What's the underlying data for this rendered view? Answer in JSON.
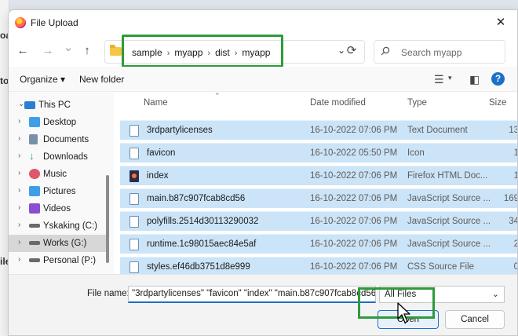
{
  "background": {
    "fragments": [
      "oa",
      "to",
      "ile"
    ]
  },
  "window": {
    "title": "File Upload",
    "close_label": "✕",
    "app_icon": "firefox-icon"
  },
  "nav": {
    "back": "←",
    "forward": "→",
    "recent": "⌄",
    "up": "↑",
    "refresh": "⟳"
  },
  "address": {
    "breadcrumb": [
      "sample",
      "myapp",
      "dist",
      "myapp"
    ]
  },
  "search": {
    "placeholder": "Search myapp"
  },
  "toolbar": {
    "organize_label": "Organize ▾",
    "new_folder_label": "New folder",
    "help_label": "?"
  },
  "sidebar": {
    "items": [
      {
        "label": "This PC",
        "chevron": "⌄",
        "icon_color": "#2a7fd4",
        "selected": false,
        "level": 0
      },
      {
        "label": "Desktop",
        "chevron": "›",
        "icon_color": "#3f9ee8",
        "selected": false,
        "level": 1
      },
      {
        "label": "Documents",
        "chevron": "›",
        "icon_color": "#7a8fa8",
        "selected": false,
        "level": 1
      },
      {
        "label": "Downloads",
        "chevron": "›",
        "icon_color": "#2f9e5b",
        "selected": false,
        "level": 1
      },
      {
        "label": "Music",
        "chevron": "›",
        "icon_color": "#e0566a",
        "selected": false,
        "level": 1
      },
      {
        "label": "Pictures",
        "chevron": "›",
        "icon_color": "#3f9ee8",
        "selected": false,
        "level": 1
      },
      {
        "label": "Videos",
        "chevron": "›",
        "icon_color": "#8a4fd0",
        "selected": false,
        "level": 1
      },
      {
        "label": "Yskaking (C:)",
        "chevron": "›",
        "icon_color": "#6a6a6a",
        "selected": false,
        "level": 1
      },
      {
        "label": "Works (G:)",
        "chevron": "›",
        "icon_color": "#6a6a6a",
        "selected": true,
        "level": 1
      },
      {
        "label": "Personal (P:)",
        "chevron": "›",
        "icon_color": "#6a6a6a",
        "selected": false,
        "level": 1
      }
    ]
  },
  "columns": {
    "name": "Name",
    "date": "Date modified",
    "type": "Type",
    "size": "Size"
  },
  "files": [
    {
      "name": "3rdpartylicenses",
      "date": "16-10-2022 07:06 PM",
      "type": "Text Document",
      "size": "13",
      "icon": "text-file-icon"
    },
    {
      "name": "favicon",
      "date": "16-10-2022 05:50 PM",
      "type": "Icon",
      "size": "1",
      "icon": "icon-file-icon"
    },
    {
      "name": "index",
      "date": "16-10-2022 07:06 PM",
      "type": "Firefox HTML Doc...",
      "size": "1",
      "icon": "html-file-icon"
    },
    {
      "name": "main.b87c907fcab8cd56",
      "date": "16-10-2022 07:06 PM",
      "type": "JavaScript Source ...",
      "size": "169",
      "icon": "js-file-icon"
    },
    {
      "name": "polyfills.2514d30113290032",
      "date": "16-10-2022 07:06 PM",
      "type": "JavaScript Source ...",
      "size": "34",
      "icon": "js-file-icon"
    },
    {
      "name": "runtime.1c98015aec84e5af",
      "date": "16-10-2022 07:06 PM",
      "type": "JavaScript Source ...",
      "size": "2",
      "icon": "js-file-icon"
    },
    {
      "name": "styles.ef46db3751d8e999",
      "date": "16-10-2022 07:06 PM",
      "type": "CSS Source File",
      "size": "0",
      "icon": "css-file-icon"
    }
  ],
  "footer": {
    "file_name_label": "File name:",
    "file_name_value": "\"3rdpartylicenses\" \"favicon\" \"index\" \"main.b87c907fcab8cd56\" \"",
    "file_type_value": "All Files",
    "open_label": "Open",
    "cancel_label": "Cancel"
  },
  "colors": {
    "highlight_border": "#2e9b3a",
    "selection_bg": "#cce4f7",
    "accent": "#1a6fc9"
  }
}
